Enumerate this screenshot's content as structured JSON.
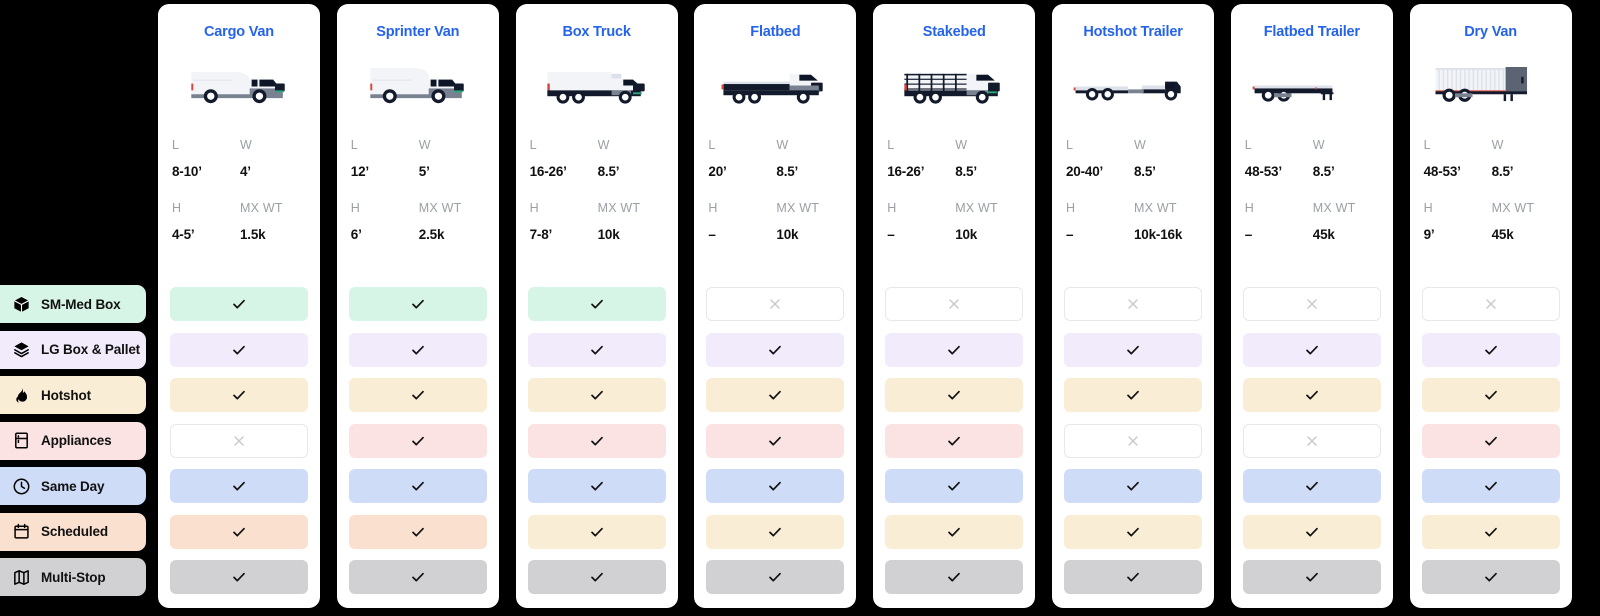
{
  "theme": {
    "background": "#000000",
    "card_bg": "#FFFFFF",
    "title_color": "#2563EB",
    "label_color": "#9AA0A6",
    "value_color": "#111111",
    "off_border": "#E8E8EA",
    "check_color": "#111111",
    "x_color": "#C9CACE"
  },
  "sidebar": {
    "items": [
      {
        "id": "sm-med-box",
        "label": "SM-Med Box",
        "icon": "box-icon",
        "color": "#D6F5E6"
      },
      {
        "id": "lg-box-pallet",
        "label": "LG Box & Pallet",
        "icon": "layers-icon",
        "color": "#F2EBFB"
      },
      {
        "id": "hotshot",
        "label": "Hotshot",
        "icon": "flame-icon",
        "color": "#FAEDD5"
      },
      {
        "id": "appliances",
        "label": "Appliances",
        "icon": "refrigerator-icon",
        "color": "#FBE3E3"
      },
      {
        "id": "same-day",
        "label": "Same Day",
        "icon": "clock-icon",
        "color": "#CFDCF7"
      },
      {
        "id": "scheduled",
        "label": "Scheduled",
        "icon": "calendar-icon",
        "color": "#FAE0CF"
      },
      {
        "id": "multi-stop",
        "label": "Multi-Stop",
        "icon": "map-icon",
        "color": "#D1D1D4"
      }
    ]
  },
  "spec_labels": {
    "length": "L",
    "width": "W",
    "height": "H",
    "max_weight": "MX WT"
  },
  "columns": [
    {
      "id": "cargo-van",
      "title": "Cargo Van",
      "art": "cargo-van",
      "specs": {
        "length": "8-10’",
        "width": "4’",
        "height": "4-5’",
        "max_weight": "1.5k"
      },
      "cells": [
        {
          "row": "sm-med-box",
          "state": "yes",
          "color": "#D6F5E6"
        },
        {
          "row": "lg-box-pallet",
          "state": "yes",
          "color": "#F2EBFB"
        },
        {
          "row": "hotshot",
          "state": "yes",
          "color": "#FAEDD5"
        },
        {
          "row": "appliances",
          "state": "no",
          "color": "#FFFFFF"
        },
        {
          "row": "same-day",
          "state": "yes",
          "color": "#CFDCF7"
        },
        {
          "row": "scheduled",
          "state": "yes",
          "color": "#FAE0CF"
        },
        {
          "row": "multi-stop",
          "state": "yes",
          "color": "#D1D1D4"
        }
      ]
    },
    {
      "id": "sprinter-van",
      "title": "Sprinter Van",
      "art": "sprinter-van",
      "specs": {
        "length": "12’",
        "width": "5’",
        "height": "6’",
        "max_weight": "2.5k"
      },
      "cells": [
        {
          "row": "sm-med-box",
          "state": "yes",
          "color": "#D6F5E6"
        },
        {
          "row": "lg-box-pallet",
          "state": "yes",
          "color": "#F2EBFB"
        },
        {
          "row": "hotshot",
          "state": "yes",
          "color": "#FAEDD5"
        },
        {
          "row": "appliances",
          "state": "yes",
          "color": "#FBE3E3"
        },
        {
          "row": "same-day",
          "state": "yes",
          "color": "#CFDCF7"
        },
        {
          "row": "scheduled",
          "state": "yes",
          "color": "#FAE0CF"
        },
        {
          "row": "multi-stop",
          "state": "yes",
          "color": "#D1D1D4"
        }
      ]
    },
    {
      "id": "box-truck",
      "title": "Box Truck",
      "art": "box-truck",
      "specs": {
        "length": "16-26’",
        "width": "8.5’",
        "height": "7-8’",
        "max_weight": "10k"
      },
      "cells": [
        {
          "row": "sm-med-box",
          "state": "yes",
          "color": "#D6F5E6"
        },
        {
          "row": "lg-box-pallet",
          "state": "yes",
          "color": "#F2EBFB"
        },
        {
          "row": "hotshot",
          "state": "yes",
          "color": "#FAEDD5"
        },
        {
          "row": "appliances",
          "state": "yes",
          "color": "#FBE3E3"
        },
        {
          "row": "same-day",
          "state": "yes",
          "color": "#CFDCF7"
        },
        {
          "row": "scheduled",
          "state": "yes",
          "color": "#FAEDD5"
        },
        {
          "row": "multi-stop",
          "state": "yes",
          "color": "#D1D1D4"
        }
      ]
    },
    {
      "id": "flatbed",
      "title": "Flatbed",
      "art": "flatbed",
      "specs": {
        "length": "20’",
        "width": "8.5’",
        "height": "–",
        "max_weight": "10k"
      },
      "cells": [
        {
          "row": "sm-med-box",
          "state": "no",
          "color": "#FFFFFF"
        },
        {
          "row": "lg-box-pallet",
          "state": "yes",
          "color": "#F2EBFB"
        },
        {
          "row": "hotshot",
          "state": "yes",
          "color": "#FAEDD5"
        },
        {
          "row": "appliances",
          "state": "yes",
          "color": "#FBE3E3"
        },
        {
          "row": "same-day",
          "state": "yes",
          "color": "#CFDCF7"
        },
        {
          "row": "scheduled",
          "state": "yes",
          "color": "#FAEDD5"
        },
        {
          "row": "multi-stop",
          "state": "yes",
          "color": "#D1D1D4"
        }
      ]
    },
    {
      "id": "stakebed",
      "title": "Stakebed",
      "art": "stakebed",
      "specs": {
        "length": "16-26’",
        "width": "8.5’",
        "height": "–",
        "max_weight": "10k"
      },
      "cells": [
        {
          "row": "sm-med-box",
          "state": "no",
          "color": "#FFFFFF"
        },
        {
          "row": "lg-box-pallet",
          "state": "yes",
          "color": "#F2EBFB"
        },
        {
          "row": "hotshot",
          "state": "yes",
          "color": "#FAEDD5"
        },
        {
          "row": "appliances",
          "state": "yes",
          "color": "#FBE3E3"
        },
        {
          "row": "same-day",
          "state": "yes",
          "color": "#CFDCF7"
        },
        {
          "row": "scheduled",
          "state": "yes",
          "color": "#FAEDD5"
        },
        {
          "row": "multi-stop",
          "state": "yes",
          "color": "#D1D1D4"
        }
      ]
    },
    {
      "id": "hotshot-trailer",
      "title": "Hotshot Trailer",
      "art": "hotshot-trailer",
      "specs": {
        "length": "20-40’",
        "width": "8.5’",
        "height": "–",
        "max_weight": "10k-16k"
      },
      "cells": [
        {
          "row": "sm-med-box",
          "state": "no",
          "color": "#FFFFFF"
        },
        {
          "row": "lg-box-pallet",
          "state": "yes",
          "color": "#F2EBFB"
        },
        {
          "row": "hotshot",
          "state": "yes",
          "color": "#FAEDD5"
        },
        {
          "row": "appliances",
          "state": "no",
          "color": "#FFFFFF"
        },
        {
          "row": "same-day",
          "state": "yes",
          "color": "#CFDCF7"
        },
        {
          "row": "scheduled",
          "state": "yes",
          "color": "#FAEDD5"
        },
        {
          "row": "multi-stop",
          "state": "yes",
          "color": "#D1D1D4"
        }
      ]
    },
    {
      "id": "flatbed-trailer",
      "title": "Flatbed Trailer",
      "art": "flatbed-trailer",
      "specs": {
        "length": "48-53’",
        "width": "8.5’",
        "height": "–",
        "max_weight": "45k"
      },
      "cells": [
        {
          "row": "sm-med-box",
          "state": "no",
          "color": "#FFFFFF"
        },
        {
          "row": "lg-box-pallet",
          "state": "yes",
          "color": "#F2EBFB"
        },
        {
          "row": "hotshot",
          "state": "yes",
          "color": "#FAEDD5"
        },
        {
          "row": "appliances",
          "state": "no",
          "color": "#FFFFFF"
        },
        {
          "row": "same-day",
          "state": "yes",
          "color": "#CFDCF7"
        },
        {
          "row": "scheduled",
          "state": "yes",
          "color": "#FAEDD5"
        },
        {
          "row": "multi-stop",
          "state": "yes",
          "color": "#D1D1D4"
        }
      ]
    },
    {
      "id": "dry-van",
      "title": "Dry Van",
      "art": "dry-van",
      "specs": {
        "length": "48-53’",
        "width": "8.5’",
        "height": "9’",
        "max_weight": "45k"
      },
      "cells": [
        {
          "row": "sm-med-box",
          "state": "no",
          "color": "#FFFFFF"
        },
        {
          "row": "lg-box-pallet",
          "state": "yes",
          "color": "#F2EBFB"
        },
        {
          "row": "hotshot",
          "state": "yes",
          "color": "#FAEDD5"
        },
        {
          "row": "appliances",
          "state": "yes",
          "color": "#FBE3E3"
        },
        {
          "row": "same-day",
          "state": "yes",
          "color": "#CFDCF7"
        },
        {
          "row": "scheduled",
          "state": "yes",
          "color": "#FAEDD5"
        },
        {
          "row": "multi-stop",
          "state": "yes",
          "color": "#D1D1D4"
        }
      ]
    }
  ]
}
